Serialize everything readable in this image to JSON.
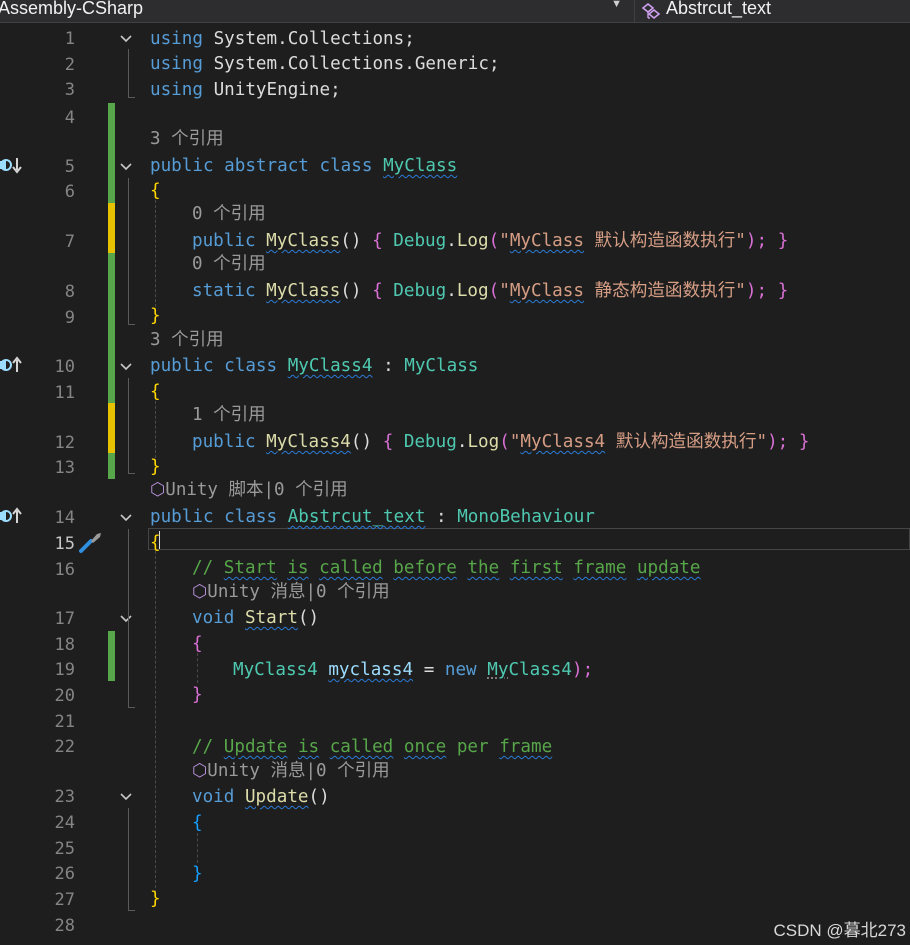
{
  "toolbar": {
    "project": "Assembly-CSharp",
    "member": "Abstrcut_text"
  },
  "editor": {
    "line_numbers": [
      "1",
      "2",
      "3",
      "4",
      "5",
      "6",
      "7",
      "8",
      "9",
      "10",
      "11",
      "12",
      "13",
      "14",
      "15",
      "16",
      "17",
      "18",
      "19",
      "20",
      "21",
      "22",
      "23",
      "24",
      "25",
      "26",
      "27",
      "28"
    ],
    "current_line": "15",
    "code": {
      "using": "using",
      "ns1": "System.Collections",
      "ns2": "System.Collections.Generic",
      "ns3": "UnityEngine",
      "semicolon": ";",
      "public": "public",
      "abstract": "abstract",
      "class": "class",
      "static": "static",
      "void": "void",
      "new": "new",
      "myclass": "MyClass",
      "myclass4": "MyClass4",
      "abstrcut_text": "Abstrcut_text",
      "monobehaviour": "MonoBehaviour",
      "colon": ":",
      "open_brace": "{",
      "close_brace": "}",
      "parens": "()",
      "debug": "Debug",
      "dot": ".",
      "log": "Log",
      "open_paren": "(",
      "close_paren_semi": ");",
      "string1_a": "\"",
      "string1_b": " 默认构造函数执行\"",
      "string2_b": " 静态构造函数执行\"",
      "string3_b": " 默认构造函数执行\"",
      "comment_slashes": "// ",
      "c_start": "Start",
      "c_is": "is",
      "c_called": "called",
      "c_before": "before",
      "c_the": "the",
      "c_first": "first",
      "c_frame": "frame",
      "c_update_lower": "update",
      "c_update": "Update",
      "c_once": "once",
      "c_per": "per",
      "start": "Start",
      "update": "Update",
      "var_myclass4": "myclass4",
      "equals": "=",
      "new_prefix": "My",
      "new_suffix": "Class4"
    },
    "codelens": {
      "refs3": "3 个引用",
      "refs0": "0 个引用",
      "refs1": "1 个引用",
      "unity_script": "Unity 脚本|0 个引用",
      "unity_message": "Unity 消息|0 个引用"
    }
  },
  "watermark": "CSDN @暮北273",
  "colors": {
    "background": "#1e1e1e",
    "keyword": "#569cd6",
    "type": "#4ec9b0",
    "method": "#dcdcaa",
    "string": "#d69d85",
    "comment": "#57a64a",
    "saved_change": "#57a64a",
    "unsaved_change": "#e5c100"
  }
}
